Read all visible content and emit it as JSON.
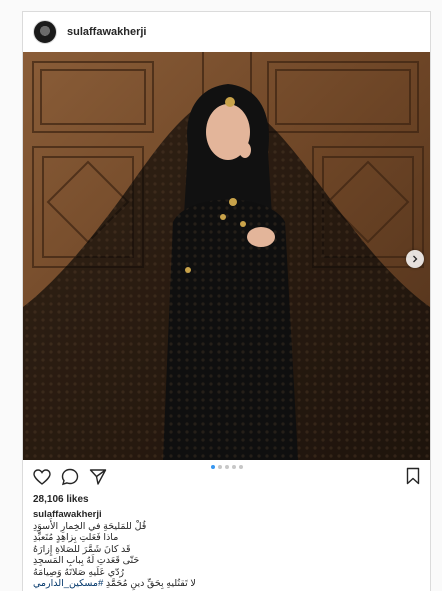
{
  "post": {
    "username": "sulaffawakherji",
    "likes": "28,106 likes",
    "caption_user": "sulaffawakherji",
    "caption_lines": [
      "قُلْ للمَليحَةِ في الخِمارِ الأَسوَدِ",
      "ماذا فَعَلتِ بِزاهِدٍ مُتَعبِّدِ",
      "قَد كانَ شَمَّرَ للصَلاةِ إِزارَهُ",
      "حَتّى قَعَدتِ لَهُ بِبابِ المَسجِدِ",
      "رُدّي عَلَيهِ صَلاتَهُ وَصِيامَهُ",
      "لا تَقتُليهِ بِحَقِّ دينِ مُحَمَّدِ"
    ],
    "hashtag": "#مسكين_الدارمي",
    "carousel": {
      "total": 5,
      "active": 0
    }
  },
  "icons": {
    "like": "heart-icon",
    "comment": "comment-icon",
    "share": "paper-plane-icon",
    "save": "bookmark-icon",
    "next": "chevron-right-icon"
  },
  "colors": {
    "accent": "#3897f0",
    "border": "#dbdbdb",
    "background": "#fafafa",
    "hashtag": "#003569"
  }
}
